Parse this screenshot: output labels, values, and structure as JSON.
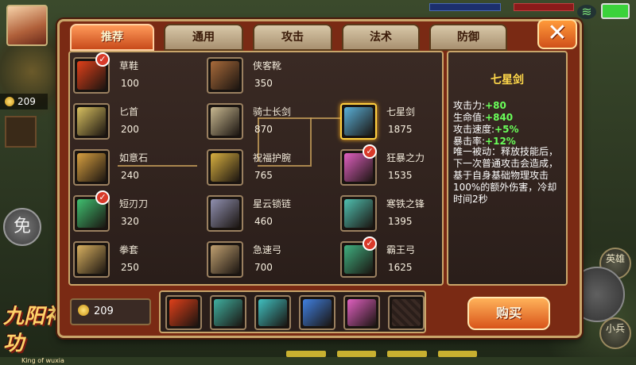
{
  "hud": {
    "gold": "209",
    "mian_label": "免",
    "hero_label": "英雄",
    "soldier_label": "小兵",
    "logo_text": "九阳神功",
    "logo_sub": "King of wuxia"
  },
  "tabs": [
    {
      "label": "推荐",
      "active": true
    },
    {
      "label": "通用",
      "active": false
    },
    {
      "label": "攻击",
      "active": false
    },
    {
      "label": "法术",
      "active": false
    },
    {
      "label": "防御",
      "active": false
    }
  ],
  "close_label": "✕",
  "items": [
    {
      "id": "caoxie",
      "name": "草鞋",
      "price": "100",
      "checked": true,
      "selected": false,
      "color": "#e0401a"
    },
    {
      "id": "xiakexue",
      "name": "侠客靴",
      "price": "350",
      "checked": false,
      "selected": false,
      "color": "#a86a3a"
    },
    {
      "id": "bishou",
      "name": "匕首",
      "price": "200",
      "checked": false,
      "selected": false,
      "color": "#d8c060"
    },
    {
      "id": "qishichangjian",
      "name": "骑士长剑",
      "price": "870",
      "checked": false,
      "selected": false,
      "color": "#c8b890"
    },
    {
      "id": "qixingjian",
      "name": "七星剑",
      "price": "1875",
      "checked": false,
      "selected": true,
      "color": "#5ab0d8"
    },
    {
      "id": "ruyishi",
      "name": "如意石",
      "price": "240",
      "checked": false,
      "selected": false,
      "color": "#d8a040"
    },
    {
      "id": "zhufuhuwan",
      "name": "祝福护腕",
      "price": "765",
      "checked": false,
      "selected": false,
      "color": "#d8b040"
    },
    {
      "id": "kuangbao",
      "name": "狂暴之力",
      "price": "1535",
      "checked": true,
      "selected": false,
      "color": "#e060c0"
    },
    {
      "id": "duanrendao",
      "name": "短刃刀",
      "price": "320",
      "checked": true,
      "selected": false,
      "color": "#40c070"
    },
    {
      "id": "xingyun",
      "name": "星云锁链",
      "price": "460",
      "checked": false,
      "selected": false,
      "color": "#9090b0"
    },
    {
      "id": "hantie",
      "name": "寒铁之锋",
      "price": "1395",
      "checked": false,
      "selected": false,
      "color": "#50c0b0"
    },
    {
      "id": "quantao",
      "name": "拳套",
      "price": "250",
      "checked": false,
      "selected": false,
      "color": "#d8b060"
    },
    {
      "id": "jisugong",
      "name": "急速弓",
      "price": "700",
      "checked": false,
      "selected": false,
      "color": "#c0a070"
    },
    {
      "id": "bawanggong",
      "name": "霸王弓",
      "price": "1625",
      "checked": true,
      "selected": false,
      "color": "#40b080"
    }
  ],
  "detail": {
    "title": "七星剑",
    "stats": [
      {
        "label": "攻击力:",
        "value": "+80"
      },
      {
        "label": "生命值:",
        "value": "+840"
      },
      {
        "label": "攻击速度:",
        "value": "+5%"
      },
      {
        "label": "暴击率:",
        "value": "+12%"
      }
    ],
    "passive": "唯一被动：释放技能后，下一次普通攻击会造成，基于自身基础物理攻击100%的额外伤害，冷却时间2秒"
  },
  "gold_box": "209",
  "recipe_colors": [
    "#e0401a",
    "#40b0a0",
    "#40c0c0",
    "#4080e0",
    "#e060c0"
  ],
  "buy_label": "购买"
}
